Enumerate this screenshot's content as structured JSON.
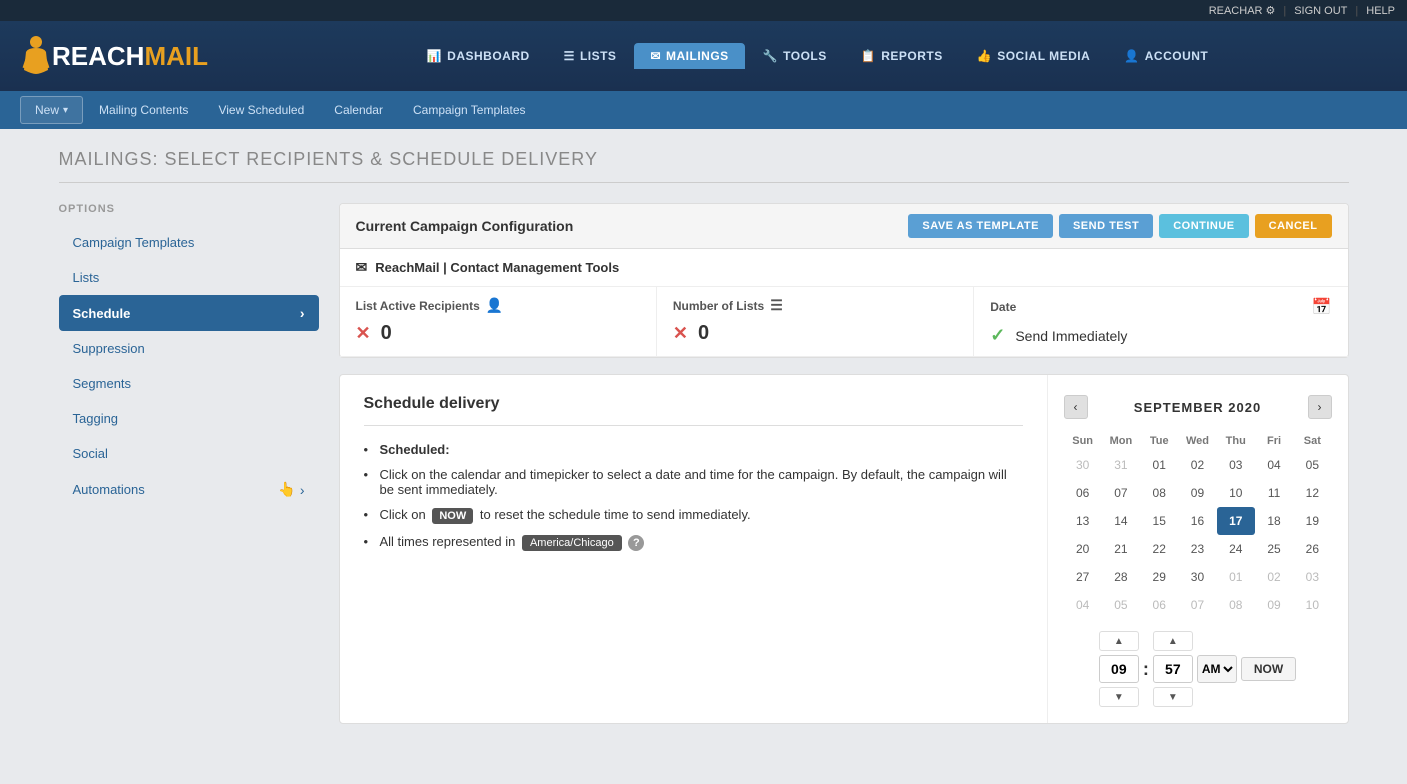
{
  "topbar": {
    "reachar_label": "REACHAR",
    "signout_label": "SIGN OUT",
    "help_label": "HELP"
  },
  "logo": {
    "reach": "REACH",
    "mail": "MAIL"
  },
  "nav": {
    "items": [
      {
        "id": "dashboard",
        "label": "DASHBOARD",
        "icon": "📊",
        "active": false
      },
      {
        "id": "lists",
        "label": "LISTS",
        "icon": "☰",
        "active": false
      },
      {
        "id": "mailings",
        "label": "MAILINGS",
        "icon": "✉",
        "active": true
      },
      {
        "id": "tools",
        "label": "TOOLS",
        "icon": "🔧",
        "active": false
      },
      {
        "id": "reports",
        "label": "REPORTS",
        "icon": "📋",
        "active": false
      },
      {
        "id": "social_media",
        "label": "SOCIAL MEDIA",
        "icon": "👍",
        "active": false
      },
      {
        "id": "account",
        "label": "ACCOUNT",
        "icon": "👤",
        "active": false
      }
    ]
  },
  "subnav": {
    "items": [
      {
        "id": "new",
        "label": "New",
        "has_dropdown": true
      },
      {
        "id": "mailing_contents",
        "label": "Mailing Contents",
        "has_dropdown": false
      },
      {
        "id": "view_scheduled",
        "label": "View Scheduled",
        "has_dropdown": false
      },
      {
        "id": "calendar",
        "label": "Calendar",
        "has_dropdown": false
      },
      {
        "id": "campaign_templates",
        "label": "Campaign Templates",
        "has_dropdown": false
      }
    ]
  },
  "page": {
    "title": "MAILINGS: SELECT RECIPIENTS & SCHEDULE DELIVERY"
  },
  "sidebar": {
    "title": "OPTIONS",
    "items": [
      {
        "id": "campaign_templates",
        "label": "Campaign Templates",
        "active": false,
        "has_arrow": false
      },
      {
        "id": "lists",
        "label": "Lists",
        "active": false,
        "has_arrow": false
      },
      {
        "id": "schedule",
        "label": "Schedule",
        "active": true,
        "has_arrow": true
      },
      {
        "id": "suppression",
        "label": "Suppression",
        "active": false,
        "has_arrow": false
      },
      {
        "id": "segments",
        "label": "Segments",
        "active": false,
        "has_arrow": false
      },
      {
        "id": "tagging",
        "label": "Tagging",
        "active": false,
        "has_arrow": false
      },
      {
        "id": "social",
        "label": "Social",
        "active": false,
        "has_arrow": false
      },
      {
        "id": "automations",
        "label": "Automations",
        "active": false,
        "has_arrow": true
      }
    ]
  },
  "campaign_config": {
    "title": "Current Campaign Configuration",
    "email_label": "ReachMail | Contact Management Tools",
    "buttons": {
      "save_template": "SAVE AS TEMPLATE",
      "send_test": "SEND TEST",
      "continue": "CONTINUE",
      "cancel": "CANCEL"
    },
    "stats": {
      "list_active_recipients": {
        "label": "List Active Recipients",
        "value": "0",
        "status": "error"
      },
      "number_of_lists": {
        "label": "Number of Lists",
        "value": "0",
        "status": "error"
      },
      "date": {
        "label": "Date",
        "value": "Send Immediately",
        "status": "success"
      }
    }
  },
  "schedule": {
    "title": "Schedule delivery",
    "bullets": [
      {
        "text": "Scheduled:",
        "bold": true
      },
      {
        "text": "Click on the calendar and timepicker to select a date and time for the campaign. By default, the campaign will be sent immediately."
      },
      {
        "text": "Click on {NOW} to reset the schedule time to send immediately."
      },
      {
        "text": "All times represented in {TIMEZONE} {HELP}"
      }
    ],
    "now_badge": "NOW",
    "timezone_badge": "America/Chicago"
  },
  "calendar": {
    "month": "SEPTEMBER 2020",
    "days_of_week": [
      "Sun",
      "Mon",
      "Tue",
      "Wed",
      "Thu",
      "Fri",
      "Sat"
    ],
    "weeks": [
      [
        "30",
        "31",
        "01",
        "02",
        "03",
        "04",
        "05"
      ],
      [
        "06",
        "07",
        "08",
        "09",
        "10",
        "11",
        "12"
      ],
      [
        "13",
        "14",
        "15",
        "16",
        "17",
        "18",
        "19"
      ],
      [
        "20",
        "21",
        "22",
        "23",
        "24",
        "25",
        "26"
      ],
      [
        "27",
        "28",
        "29",
        "30",
        "01",
        "02",
        "03"
      ],
      [
        "04",
        "05",
        "06",
        "07",
        "08",
        "09",
        "10"
      ]
    ],
    "other_month_days": [
      "30",
      "31",
      "01",
      "02",
      "03",
      "04",
      "05",
      "01",
      "02",
      "03",
      "04",
      "05",
      "06",
      "07",
      "08",
      "09",
      "10"
    ],
    "today_date": "17",
    "today_week": 2,
    "today_col": 4
  },
  "timepicker": {
    "hour": "09",
    "minute": "57",
    "ampm": "AM",
    "now_label": "NOW"
  }
}
